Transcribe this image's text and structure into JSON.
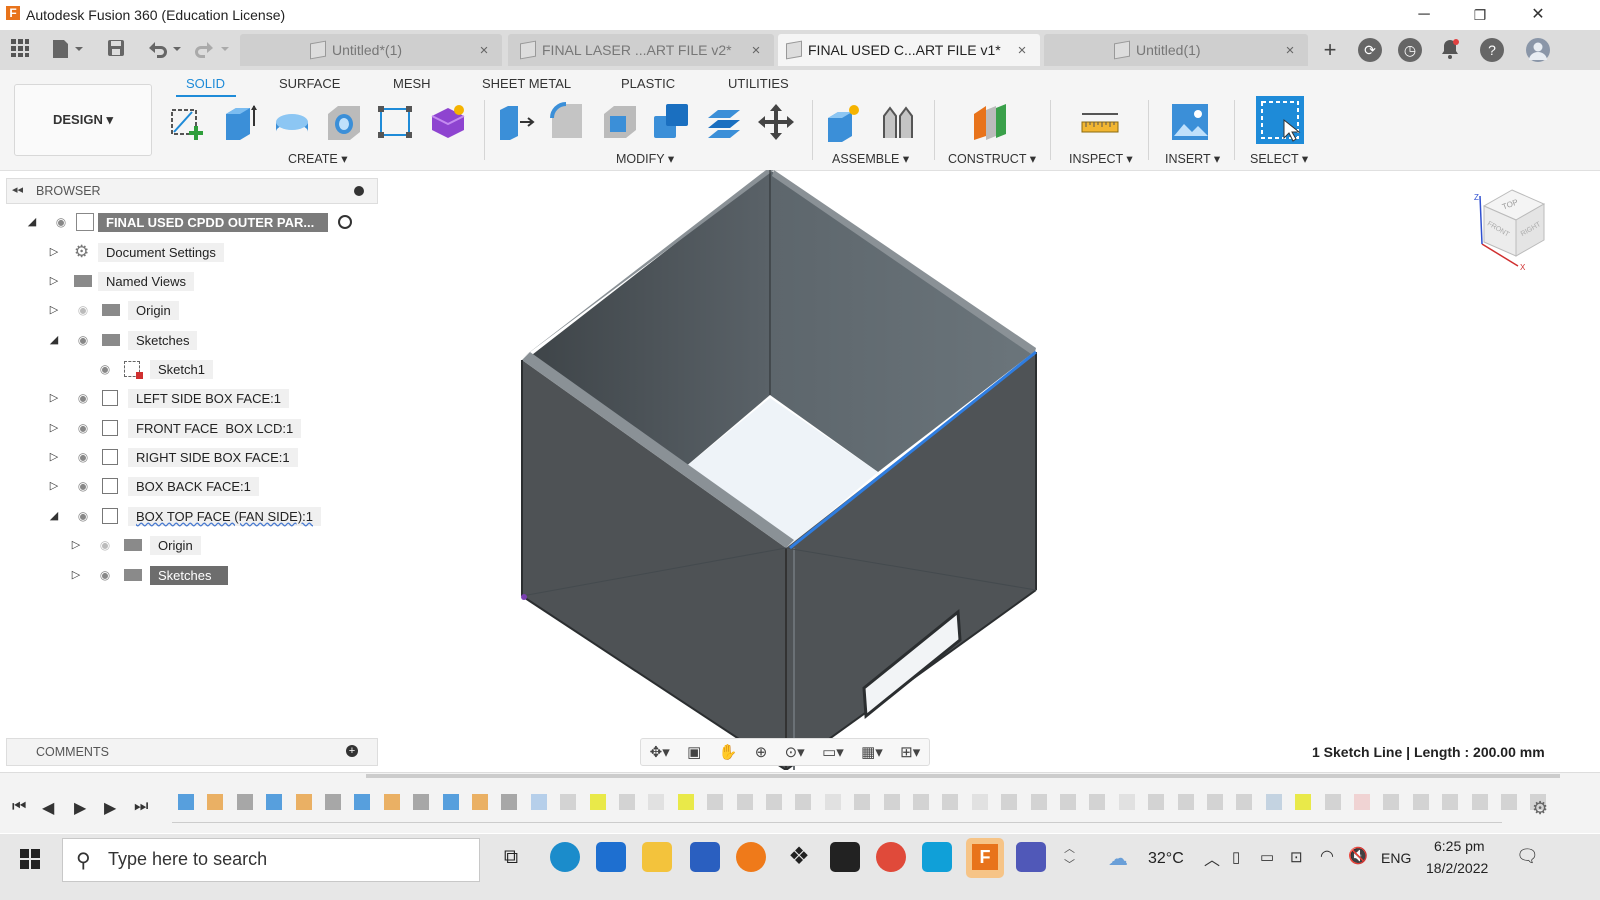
{
  "window": {
    "title": "Autodesk Fusion 360 (Education License)",
    "logo_letter": "F",
    "minimize": "─",
    "restore": "❐",
    "close": "✕"
  },
  "tabs": [
    {
      "label": "Untitled*(1)",
      "close": "×"
    },
    {
      "label": "FINAL LASER ...ART FILE v2*",
      "close": "×"
    },
    {
      "label": "FINAL USED C...ART FILE v1*",
      "close": "×"
    },
    {
      "label": "Untitled(1)",
      "close": "×"
    }
  ],
  "ribbon": {
    "tabs": [
      "SOLID",
      "SURFACE",
      "MESH",
      "SHEET METAL",
      "PLASTIC",
      "UTILITIES"
    ],
    "workspace": "DESIGN ▾",
    "groups": [
      "CREATE ▾",
      "MODIFY ▾",
      "ASSEMBLE ▾",
      "CONSTRUCT ▾",
      "INSPECT ▾",
      "INSERT ▾",
      "SELECT ▾"
    ]
  },
  "browser": {
    "title": "BROWSER",
    "collapse": "◂◂",
    "items": [
      {
        "label": "FINAL USED CPDD OUTER PAR..."
      },
      {
        "label": "Document Settings"
      },
      {
        "label": "Named Views"
      },
      {
        "label": "Origin"
      },
      {
        "label": "Sketches"
      },
      {
        "label": "Sketch1"
      },
      {
        "label": "LEFT SIDE BOX FACE:1"
      },
      {
        "label": "FRONT FACE  BOX LCD:1"
      },
      {
        "label": "RIGHT SIDE BOX FACE:1"
      },
      {
        "label": "BOX BACK FACE:1"
      },
      {
        "label": "BOX TOP FACE (FAN SIDE):1"
      },
      {
        "label": "Origin"
      },
      {
        "label": "Sketches"
      }
    ]
  },
  "comments": {
    "title": "COMMENTS",
    "add": "+"
  },
  "status": {
    "text": "1 Sketch Line | Length : 200.00 mm"
  },
  "viewcube": {
    "top": "TOP",
    "front": "FRONT",
    "right": "RIGHT"
  },
  "taskbar": {
    "search_placeholder": "Type here to search",
    "temperature": "32°C",
    "language": "ENG",
    "time": "6:25 pm",
    "date": "18/2/2022"
  },
  "colors": {
    "accent": "#1e8bd8",
    "fusion_orange": "#e8731b",
    "box_body": "#4e5255",
    "selected_edge": "#2f7de0"
  }
}
